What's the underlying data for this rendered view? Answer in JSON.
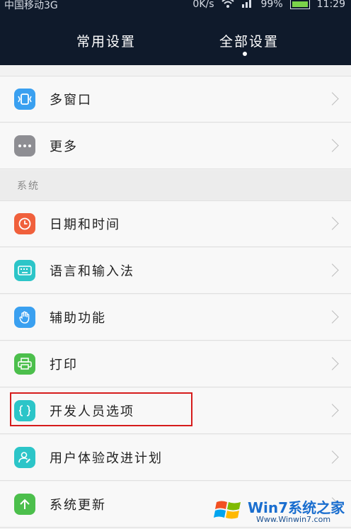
{
  "status_bar": {
    "carrier": "中国移动3G",
    "speed": "0K/s",
    "battery": "99%",
    "time": "11:29"
  },
  "tabs": [
    {
      "label": "常用设置"
    },
    {
      "label": "全部设置"
    }
  ],
  "active_tab": "全部设置",
  "items_top": [
    {
      "label": "多窗口",
      "icon": "multi-window-icon",
      "color": "#3aa0f0"
    },
    {
      "label": "更多",
      "icon": "more-dots-icon",
      "color": "#8e8e93"
    }
  ],
  "section_system": {
    "label": "系统"
  },
  "items_system": [
    {
      "label": "日期和时间",
      "icon": "clock-icon",
      "color": "#f0603c"
    },
    {
      "label": "语言和输入法",
      "icon": "keyboard-icon",
      "color": "#2cc5c8"
    },
    {
      "label": "辅助功能",
      "icon": "hand-icon",
      "color": "#3aa0f0"
    },
    {
      "label": "打印",
      "icon": "printer-icon",
      "color": "#4cbf4c"
    },
    {
      "label": "开发人员选项",
      "icon": "braces-icon",
      "color": "#2cc5c8"
    },
    {
      "label": "用户体验改进计划",
      "icon": "user-edit-icon",
      "color": "#2cc5c8"
    },
    {
      "label": "系统更新",
      "icon": "arrow-up-icon",
      "color": "#4cbf4c"
    }
  ],
  "highlight_item": "开发人员选项",
  "watermark": {
    "text": "Win7系统之家",
    "url": "Www.Winwin7.com"
  },
  "colors": {
    "header_bg": "#0f1a2b",
    "highlight_border": "#d61c1c"
  }
}
